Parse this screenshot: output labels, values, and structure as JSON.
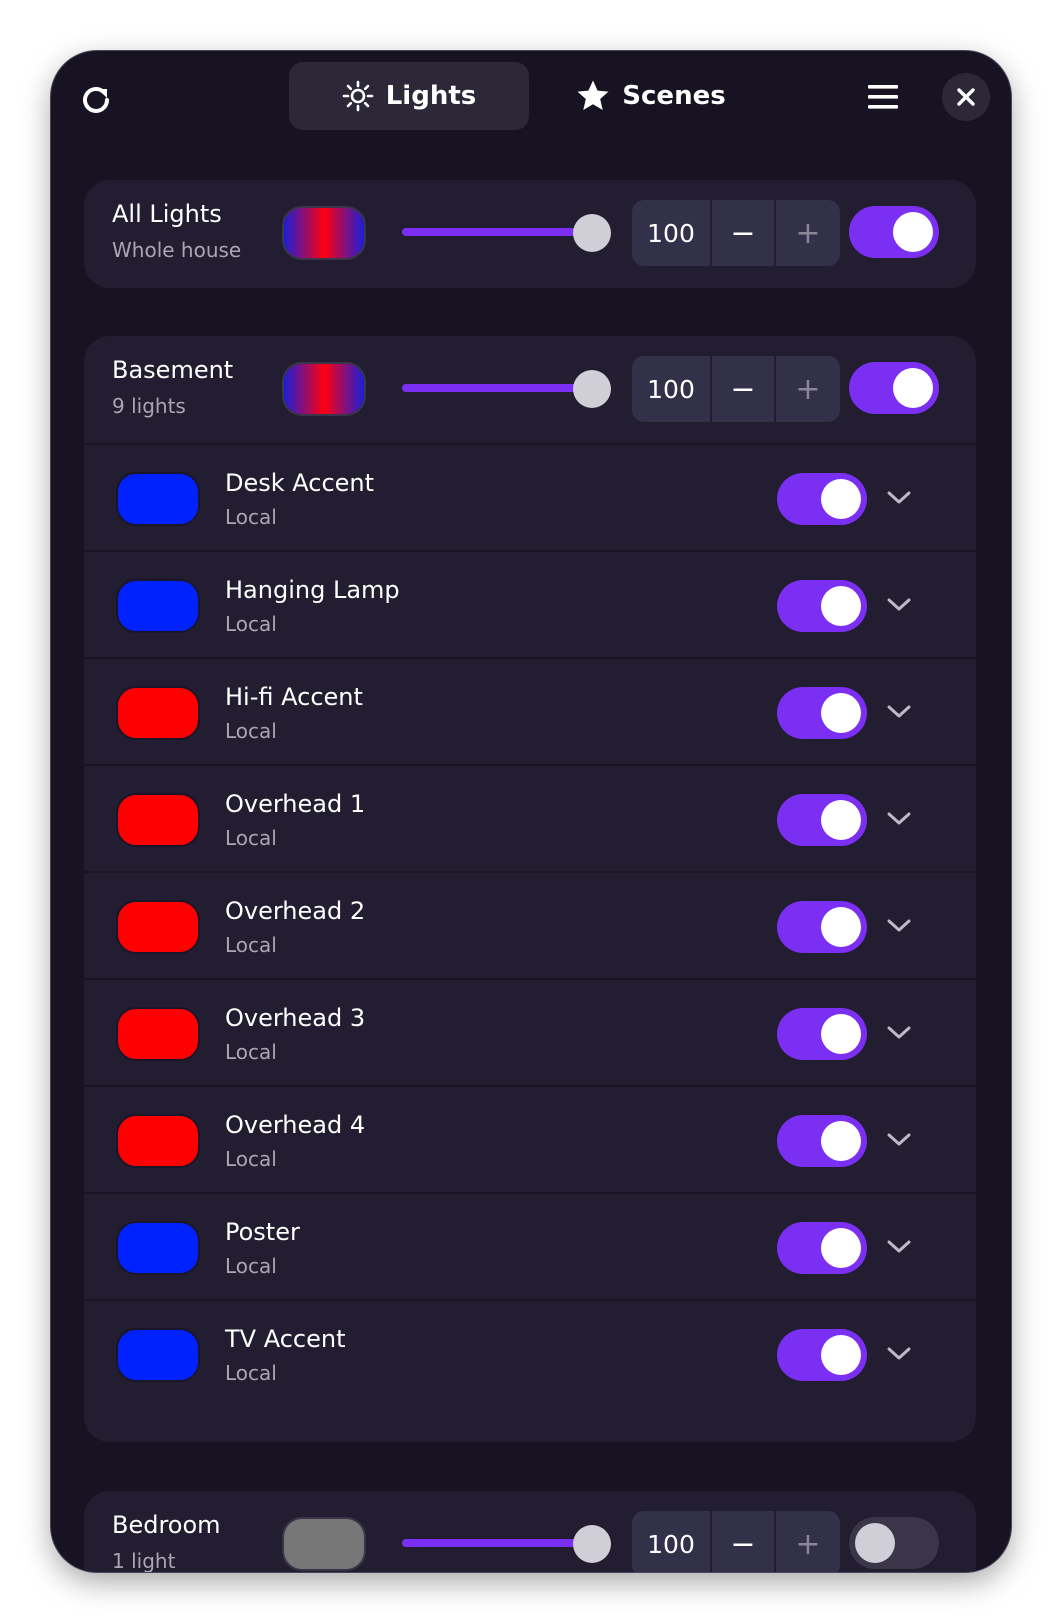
{
  "header": {
    "tabs": [
      {
        "label": "Lights",
        "icon": "sun-icon",
        "active": true
      },
      {
        "label": "Scenes",
        "icon": "star-icon",
        "active": false
      }
    ]
  },
  "all_lights": {
    "title": "All Lights",
    "subtitle": "Whole house",
    "swatch_colors": [
      "#1a1fd8",
      "#ff0010",
      "#1a1fd8"
    ],
    "brightness": 100,
    "brightness_text": "100",
    "on": true
  },
  "groups": [
    {
      "title": "Basement",
      "subtitle": "9 lights",
      "swatch_colors": [
        "#1a1fd8",
        "#ff0010",
        "#1a1fd8"
      ],
      "brightness": 100,
      "brightness_text": "100",
      "on": true,
      "lights": [
        {
          "name": "Desk Accent",
          "source": "Local",
          "color": "#0022ff",
          "on": true
        },
        {
          "name": "Hanging Lamp",
          "source": "Local",
          "color": "#0022ff",
          "on": true
        },
        {
          "name": "Hi-fi Accent",
          "source": "Local",
          "color": "#ff0000",
          "on": true
        },
        {
          "name": "Overhead 1",
          "source": "Local",
          "color": "#ff0000",
          "on": true
        },
        {
          "name": "Overhead 2",
          "source": "Local",
          "color": "#ff0000",
          "on": true
        },
        {
          "name": "Overhead 3",
          "source": "Local",
          "color": "#ff0000",
          "on": true
        },
        {
          "name": "Overhead 4",
          "source": "Local",
          "color": "#ff0000",
          "on": true
        },
        {
          "name": "Poster",
          "source": "Local",
          "color": "#0022ff",
          "on": true
        },
        {
          "name": "TV Accent",
          "source": "Local",
          "color": "#0022ff",
          "on": true
        }
      ]
    },
    {
      "title": "Bedroom",
      "subtitle": "1 light",
      "swatch_colors": [
        "#777777"
      ],
      "brightness": 100,
      "brightness_text": "100",
      "on": false,
      "lights": []
    }
  ],
  "stepper": {
    "minus": "−",
    "plus": "+"
  },
  "colors": {
    "accent": "#7b2ff2",
    "background": "#171322",
    "card": "#221d30"
  }
}
